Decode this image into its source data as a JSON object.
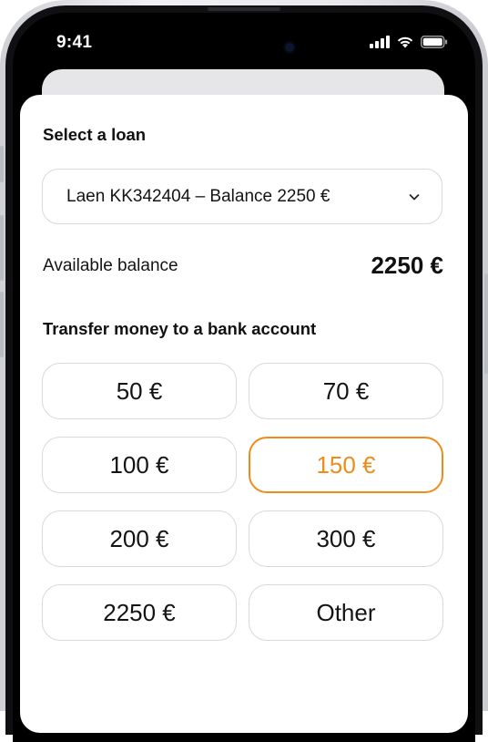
{
  "status_bar": {
    "time": "9:41"
  },
  "loan_section": {
    "title": "Select a loan",
    "selected_loan": "Laen KK342404 – Balance 2250 €"
  },
  "balance": {
    "label": "Available balance",
    "value": "2250 €"
  },
  "transfer_section": {
    "title": "Transfer money to a bank account",
    "amounts": [
      "50 €",
      "70 €",
      "100 €",
      "150 €",
      "200 €",
      "300 €",
      "2250 €",
      "Other"
    ],
    "selected_amount": "150 €"
  },
  "colors": {
    "accent": "#ee8c1a",
    "border": "#d9d9dc",
    "sheet_back": "#e6e6e9"
  }
}
